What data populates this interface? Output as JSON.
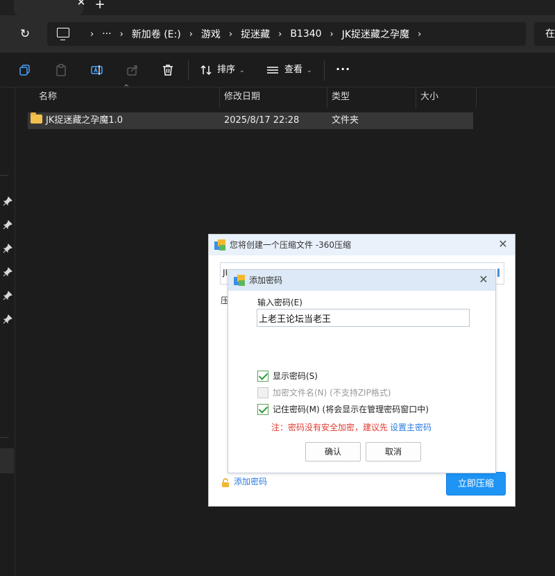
{
  "tab": {
    "close_glyph": "✕",
    "new_glyph": "+"
  },
  "address": {
    "refresh_glyph": "↻",
    "crumbs": [
      "···",
      "新加卷 (E:)",
      "游戏",
      "捉迷藏",
      "B1340",
      "JK捉迷藏之孕魔"
    ],
    "crumb_separator": "›",
    "search_partial": "在"
  },
  "toolbar": {
    "sort_label": "排序",
    "view_label": "查看",
    "more_glyph": "···",
    "chevron": "⌄"
  },
  "file_list": {
    "columns": {
      "name": "名称",
      "modified": "修改日期",
      "type": "类型",
      "size": "大小"
    },
    "sort_caret": "^",
    "rows": [
      {
        "name": "JK捉迷藏之孕魔1.0",
        "modified": "2025/8/17 22:28",
        "type": "文件夹",
        "size": ""
      }
    ]
  },
  "compress_dialog": {
    "title": "您将创建一个压缩文件 -360压缩",
    "close_glyph": "✕",
    "field_partial": "JI",
    "label_partial": "压",
    "add_password_link": "添加密码",
    "compress_button": "立即压缩"
  },
  "password_dialog": {
    "title": "添加密码",
    "close_glyph": "✕",
    "input_label": "输入密码(E)",
    "password_value": "上老王论坛当老王",
    "show_password": {
      "label": "显示密码(S)",
      "checked": true
    },
    "encrypt_filenames": {
      "label": "加密文件名(N) (不支持ZIP格式)",
      "checked": false,
      "disabled": true
    },
    "remember_password": {
      "label": "记住密码(M) (将会显示在管理密码窗口中)",
      "checked": true
    },
    "note_text": "注：密码没有安全加密，建议先",
    "note_link": "设置主密码",
    "ok_button": "确认",
    "cancel_button": "取消"
  },
  "colors": {
    "explorer_bg": "#1c1c1c",
    "accent_blue": "#1e94f5",
    "warning_red": "#e03a2f",
    "link_blue": "#2a7ae2",
    "folder_yellow": "#f2c04e"
  },
  "icons": [
    "copy-icon",
    "paste-icon",
    "rename-icon",
    "share-icon",
    "delete-icon",
    "sort-icon",
    "view-icon",
    "pin-icon",
    "folder-icon",
    "lock-icon",
    "app-360-icon",
    "pc-icon"
  ]
}
